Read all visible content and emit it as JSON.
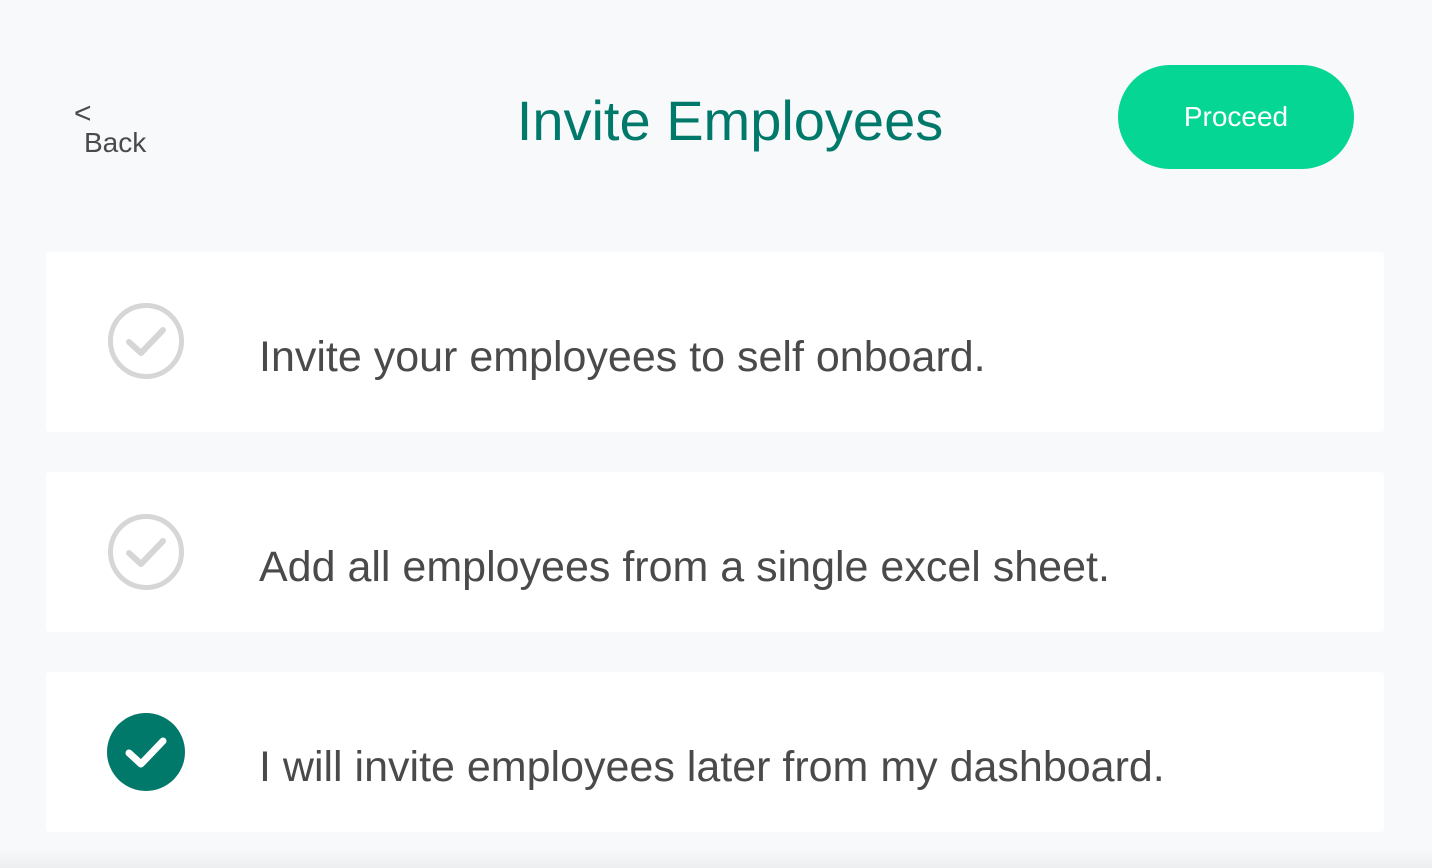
{
  "header": {
    "back_chevron": "<",
    "back_label": "Back",
    "title": "Invite Employees",
    "proceed_label": "Proceed"
  },
  "options": [
    {
      "label": "Invite your employees to self onboard.",
      "selected": false,
      "icon": "check-circle-outline-icon"
    },
    {
      "label": "Add all employees from a single excel sheet.",
      "selected": false,
      "icon": "check-circle-outline-icon"
    },
    {
      "label": "I will invite employees later from my dashboard.",
      "selected": true,
      "icon": "check-circle-filled-icon"
    }
  ],
  "colors": {
    "background": "#f8f9fb",
    "title": "#00796b",
    "proceed_button": "#05d693",
    "selected_check": "#00796b",
    "unselected_check": "#d6d6d6",
    "text": "#4a4a4a"
  }
}
